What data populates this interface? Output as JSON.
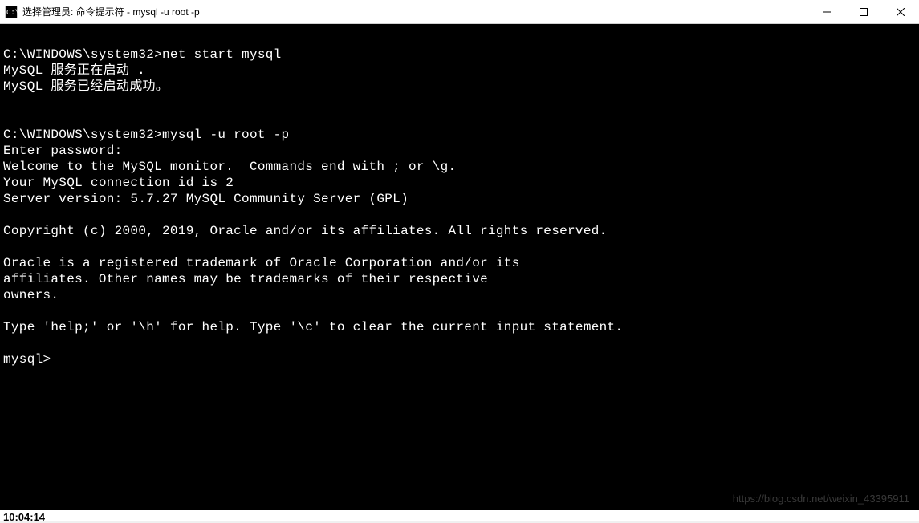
{
  "titlebar": {
    "title": "选择管理员: 命令提示符 - mysql  -u root -p"
  },
  "terminal": {
    "lines": [
      "",
      "C:\\WINDOWS\\system32>net start mysql",
      "MySQL 服务正在启动 .",
      "MySQL 服务已经启动成功。",
      "",
      "",
      "C:\\WINDOWS\\system32>mysql -u root -p",
      "Enter password:",
      "Welcome to the MySQL monitor.  Commands end with ; or \\g.",
      "Your MySQL connection id is 2",
      "Server version: 5.7.27 MySQL Community Server (GPL)",
      "",
      "Copyright (c) 2000, 2019, Oracle and/or its affiliates. All rights reserved.",
      "",
      "Oracle is a registered trademark of Oracle Corporation and/or its",
      "affiliates. Other names may be trademarks of their respective",
      "owners.",
      "",
      "Type 'help;' or '\\h' for help. Type '\\c' to clear the current input statement.",
      "",
      "mysql>"
    ]
  },
  "watermark": "https://blog.csdn.net/weixin_43395911",
  "bottom_time": "10:04:14"
}
